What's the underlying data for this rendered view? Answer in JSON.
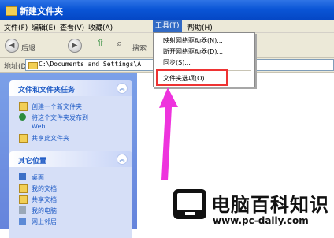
{
  "window": {
    "title": "新建文件夹"
  },
  "menubar": {
    "items": [
      "文件(F)",
      "编辑(E)",
      "查看(V)",
      "收藏(A)",
      "工具(T)",
      "帮助(H)"
    ],
    "active": "工具(T)"
  },
  "toolbar": {
    "back": "后退",
    "search": "搜索"
  },
  "address": {
    "label": "地址(D)",
    "value": "C:\\Documents and Settings\\A"
  },
  "tools_menu": {
    "items": [
      "映射网络驱动器(N)...",
      "断开网络驱动器(D)...",
      "同步(S)...",
      "文件夹选项(O)..."
    ],
    "highlighted": "文件夹选项(O)...",
    "highlight_color": "#e33333"
  },
  "task_panel": {
    "title": "文件和文件夹任务",
    "items": [
      "创建一个新文件夹",
      "将这个文件夹发布到",
      "Web",
      "共享此文件夹"
    ]
  },
  "places_panel": {
    "title": "其它位置",
    "items": [
      "桌面",
      "我的文档",
      "共享文档",
      "我的电脑",
      "网上邻居"
    ]
  },
  "watermark": {
    "name": "电脑百科知识",
    "url": "www.pc-daily.com"
  },
  "colors": {
    "titlebar": "#0a55d6",
    "sidepane": "#6f92e2",
    "arrow": "#ee33dd",
    "link": "#215dc6"
  }
}
